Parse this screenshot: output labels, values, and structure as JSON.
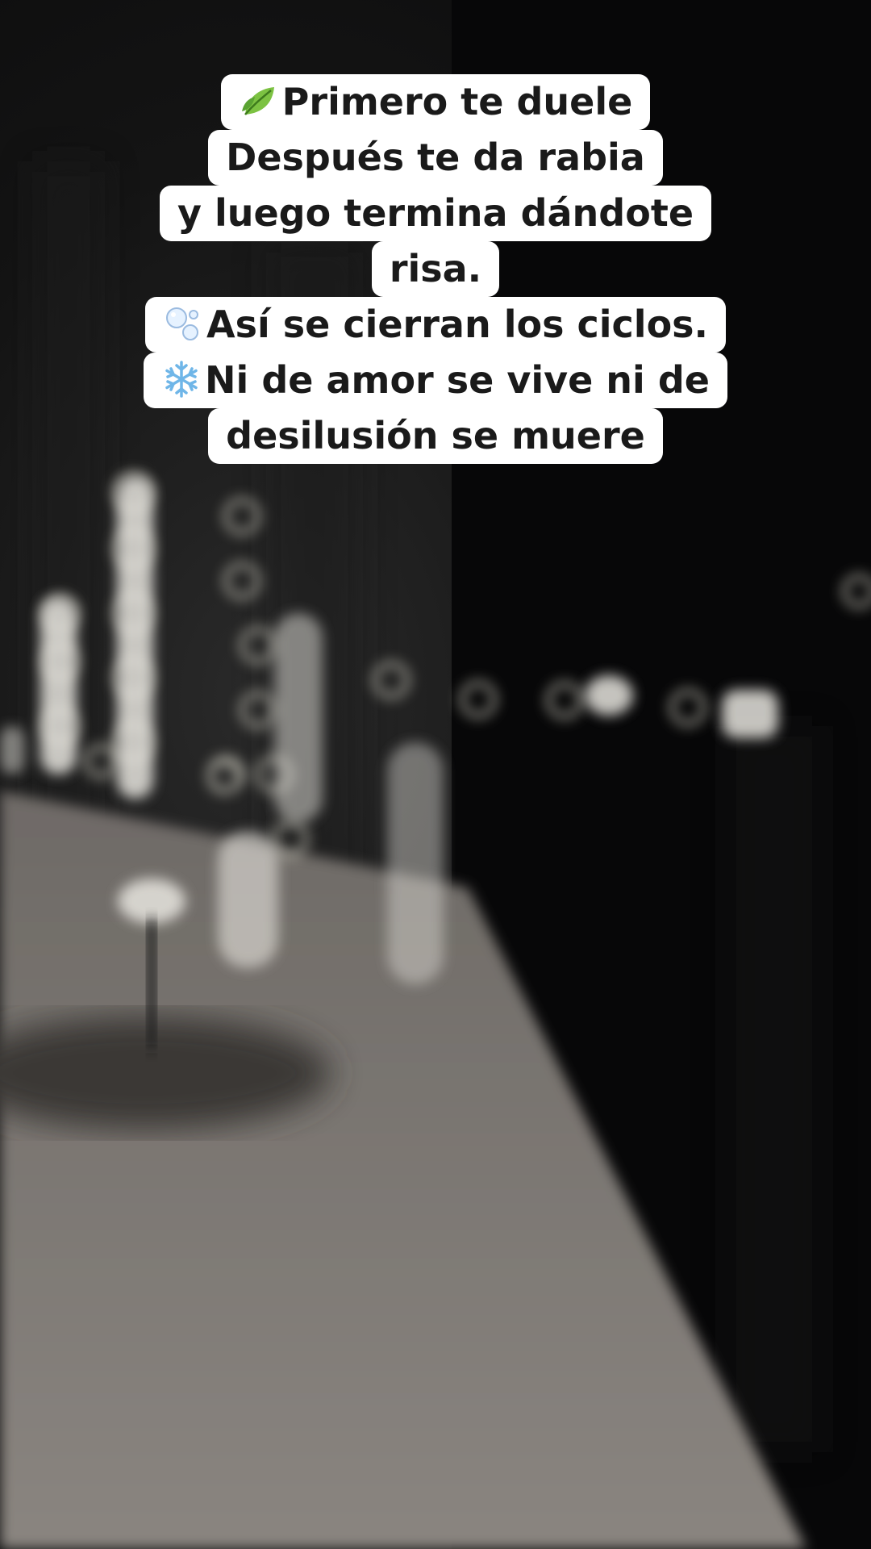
{
  "caption": {
    "lines": [
      {
        "icon": "leaf-icon",
        "text": "Primero te duele"
      },
      {
        "icon": "",
        "text": "Después te da rabia"
      },
      {
        "icon": "",
        "text": "y luego termina dándote"
      },
      {
        "icon": "",
        "text": "risa."
      },
      {
        "icon": "bubbles-icon",
        "text": "Así se cierran los ciclos."
      },
      {
        "icon": "snowflake-icon",
        "text": "Ni de amor se vive ni de"
      },
      {
        "icon": "",
        "text": "desilusión se muere"
      }
    ]
  },
  "colors": {
    "caption_bg": "#ffffff",
    "caption_text": "#1a1a1a",
    "scene_dark": "#0b0b0c",
    "counter_gray": "#7d7873",
    "bokeh": "#d8d6c8"
  }
}
